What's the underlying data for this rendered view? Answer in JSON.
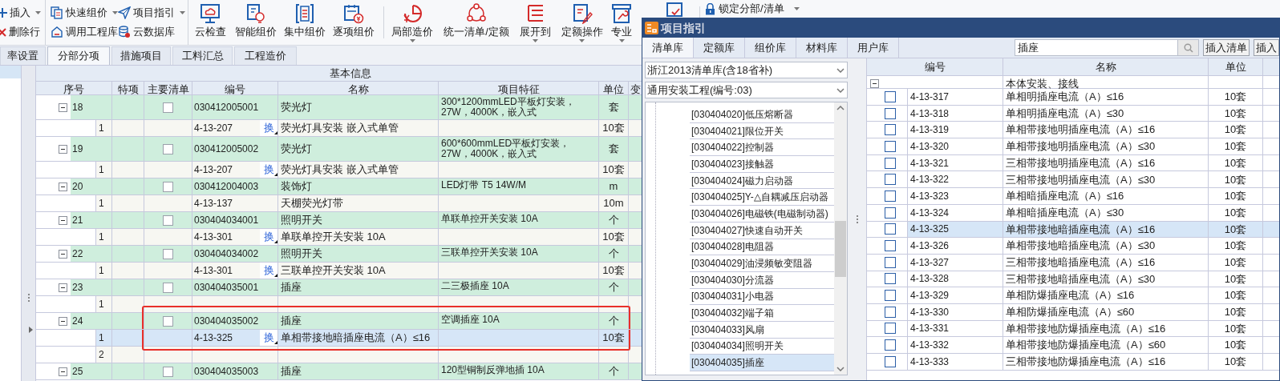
{
  "toolbar": {
    "small_buttons": [
      {
        "label": "插入",
        "dropdown": true
      },
      {
        "label": "删除行",
        "dropdown": false
      },
      {
        "label": "快速组价",
        "dropdown": true
      },
      {
        "label": "调用工程库",
        "dropdown": false
      },
      {
        "label": "项目指引",
        "dropdown": true
      },
      {
        "label": "云数据库",
        "dropdown": false
      }
    ],
    "large_buttons": [
      {
        "label": "云检查",
        "dropdown": false
      },
      {
        "label": "智能组价",
        "dropdown": false
      },
      {
        "label": "集中组价",
        "dropdown": false
      },
      {
        "label": "逐项组价",
        "dropdown": false
      },
      {
        "label": "局部造价",
        "dropdown": true
      },
      {
        "label": "统一清单/定额",
        "dropdown": false
      },
      {
        "label": "展开到",
        "dropdown": true
      },
      {
        "label": "定额操作",
        "dropdown": true
      },
      {
        "label": "专业",
        "dropdown": true
      }
    ],
    "lock_button": {
      "label": "锁定分部/清单",
      "dropdown": true
    }
  },
  "tabs": [
    {
      "label": "率设置",
      "selected": false
    },
    {
      "label": "分部分项",
      "selected": true
    },
    {
      "label": "措施项目",
      "selected": false
    },
    {
      "label": "工料汇总",
      "selected": false
    },
    {
      "label": "工程造价",
      "selected": false
    }
  ],
  "table": {
    "group_header": "基本信息",
    "columns": [
      "序号",
      "特项",
      "主要清单",
      "编号",
      "名称",
      "项目特征",
      "单位",
      "变"
    ],
    "rows": [
      {
        "kind": "item",
        "seq": "18",
        "expanded": true,
        "main_checked": false,
        "code": "030412005001",
        "name": "荧光灯",
        "features": "300*1200mmLED平板灯安装，27W，4000K，嵌入式",
        "unit": "套",
        "highlighted": false
      },
      {
        "kind": "sub",
        "seq": "1",
        "code": "4-13-207",
        "swap": "换",
        "name": "荧光灯具安装 嵌入式单管",
        "unit": "10套",
        "selected": false,
        "highlighted": false
      },
      {
        "kind": "item",
        "seq": "19",
        "expanded": true,
        "main_checked": false,
        "code": "030412005002",
        "name": "荧光灯",
        "features": "600*600mmLED平板灯安装，27W，4000K，嵌入式",
        "unit": "套",
        "highlighted": false
      },
      {
        "kind": "sub",
        "seq": "1",
        "code": "4-13-207",
        "swap": "换",
        "name": "荧光灯具安装 嵌入式单管",
        "unit": "10套",
        "selected": false,
        "highlighted": false
      },
      {
        "kind": "item",
        "seq": "20",
        "expanded": true,
        "main_checked": false,
        "code": "030412004003",
        "name": "装饰灯",
        "features": "LED灯带 T5 14W/M",
        "unit": "m",
        "highlighted": false
      },
      {
        "kind": "sub",
        "seq": "1",
        "code": "4-13-137",
        "name": "天棚荧光灯带",
        "unit": "10m",
        "selected": false,
        "highlighted": false
      },
      {
        "kind": "item",
        "seq": "21",
        "expanded": true,
        "main_checked": false,
        "code": "030404034001",
        "name": "照明开关",
        "features": "单联单控开关安装 10A",
        "unit": "个",
        "highlighted": false
      },
      {
        "kind": "sub",
        "seq": "1",
        "code": "4-13-301",
        "swap": "换",
        "name": "单联单控开关安装 10A",
        "unit": "10套",
        "selected": false,
        "highlighted": false
      },
      {
        "kind": "item",
        "seq": "22",
        "expanded": true,
        "main_checked": false,
        "code": "030404034002",
        "name": "照明开关",
        "features": "三联单控开关安装 10A",
        "unit": "个",
        "highlighted": false
      },
      {
        "kind": "sub",
        "seq": "1",
        "code": "4-13-301",
        "swap": "换",
        "name": "三联单控开关安装 10A",
        "unit": "10套",
        "selected": false,
        "highlighted": false
      },
      {
        "kind": "item",
        "seq": "23",
        "expanded": true,
        "main_checked": false,
        "code": "030404035001",
        "name": "插座",
        "features": "二三极插座 10A",
        "unit": "个",
        "highlighted": false
      },
      {
        "kind": "sub",
        "seq": "1",
        "selected": false,
        "highlighted": false
      },
      {
        "kind": "item",
        "seq": "24",
        "expanded": true,
        "main_checked": false,
        "code": "030404035002",
        "name": "插座",
        "features": "空调插座 10A",
        "unit": "个",
        "highlighted": true
      },
      {
        "kind": "sub",
        "seq": "1",
        "code": "4-13-325",
        "swap": "换",
        "name": "单相带接地暗插座电流（A）≤16",
        "unit": "10套",
        "selected": true,
        "highlighted": true
      },
      {
        "kind": "sub",
        "seq": "2",
        "selected": false,
        "highlighted": false
      },
      {
        "kind": "item",
        "seq": "25",
        "expanded": true,
        "main_checked": false,
        "code": "030404035003",
        "name": "插座",
        "features": "120型铜制反弹地插 10A",
        "unit": "个",
        "highlighted": false
      }
    ]
  },
  "dialog": {
    "title": "项目指引",
    "tabs": [
      {
        "label": "清单库",
        "selected": true
      },
      {
        "label": "定额库",
        "selected": false
      },
      {
        "label": "组价库",
        "selected": false
      },
      {
        "label": "材料库",
        "selected": false
      },
      {
        "label": "用户库",
        "selected": false
      }
    ],
    "search": {
      "value": "插座"
    },
    "buttons": [
      "插入清单",
      "插入"
    ],
    "library_select": "浙江2013清单库(含18省补)",
    "profession_select": "通用安装工程(编号:03)",
    "tree_items": [
      {
        "label": "[030404020]低压熔断器",
        "selected": false
      },
      {
        "label": "[030404021]限位开关",
        "selected": false
      },
      {
        "label": "[030404022]控制器",
        "selected": false
      },
      {
        "label": "[030404023]接触器",
        "selected": false
      },
      {
        "label": "[030404024]磁力启动器",
        "selected": false
      },
      {
        "label": "[030404025]Y-△自耦减压启动器",
        "selected": false
      },
      {
        "label": "[030404026]电磁铁(电磁制动器)",
        "selected": false
      },
      {
        "label": "[030404027]快速自动开关",
        "selected": false
      },
      {
        "label": "[030404028]电阻器",
        "selected": false
      },
      {
        "label": "[030404029]油浸频敏变阻器",
        "selected": false
      },
      {
        "label": "[030404030]分流器",
        "selected": false
      },
      {
        "label": "[030404031]小电器",
        "selected": false
      },
      {
        "label": "[030404032]端子箱",
        "selected": false
      },
      {
        "label": "[030404033]风扇",
        "selected": false
      },
      {
        "label": "[030404034]照明开关",
        "selected": false
      },
      {
        "label": "[030404035]插座",
        "selected": true
      }
    ],
    "grid": {
      "columns": [
        "编号",
        "名称",
        "单位"
      ],
      "group": {
        "name": "本体安装、接线",
        "expanded": true,
        "children": [
          {
            "code": "4-13-317",
            "name": "单相明插座电流（A）≤16",
            "unit": "10套",
            "checked": false,
            "selected": false
          },
          {
            "code": "4-13-318",
            "name": "单相明插座电流（A）≤30",
            "unit": "10套",
            "checked": false,
            "selected": false
          },
          {
            "code": "4-13-319",
            "name": "单相带接地明插座电流（A）≤16",
            "unit": "10套",
            "checked": false,
            "selected": false
          },
          {
            "code": "4-13-320",
            "name": "单相带接地明插座电流（A）≤30",
            "unit": "10套",
            "checked": false,
            "selected": false
          },
          {
            "code": "4-13-321",
            "name": "三相带接地明插座电流（A）≤16",
            "unit": "10套",
            "checked": false,
            "selected": false
          },
          {
            "code": "4-13-322",
            "name": "三相带接地明插座电流（A）≤30",
            "unit": "10套",
            "checked": false,
            "selected": false
          },
          {
            "code": "4-13-323",
            "name": "单相暗插座电流（A）≤16",
            "unit": "10套",
            "checked": false,
            "selected": false
          },
          {
            "code": "4-13-324",
            "name": "单相暗插座电流（A）≤30",
            "unit": "10套",
            "checked": false,
            "selected": false
          },
          {
            "code": "4-13-325",
            "name": "单相带接地暗插座电流（A）≤16",
            "unit": "10套",
            "checked": false,
            "selected": true
          },
          {
            "code": "4-13-326",
            "name": "单相带接地暗插座电流（A）≤30",
            "unit": "10套",
            "checked": false,
            "selected": false
          },
          {
            "code": "4-13-327",
            "name": "三相带接地暗插座电流（A）≤16",
            "unit": "10套",
            "checked": false,
            "selected": false
          },
          {
            "code": "4-13-328",
            "name": "三相带接地暗插座电流（A）≤30",
            "unit": "10套",
            "checked": false,
            "selected": false
          },
          {
            "code": "4-13-329",
            "name": "单相防爆插座电流（A）≤16",
            "unit": "10套",
            "checked": false,
            "selected": false
          },
          {
            "code": "4-13-330",
            "name": "单相防爆插座电流（A）≤60",
            "unit": "10套",
            "checked": false,
            "selected": false
          },
          {
            "code": "4-13-331",
            "name": "单相带接地防爆插座电流（A）≤16",
            "unit": "10套",
            "checked": false,
            "selected": false
          },
          {
            "code": "4-13-332",
            "name": "单相带接地防爆插座电流（A）≤60",
            "unit": "10套",
            "checked": false,
            "selected": false
          },
          {
            "code": "4-13-333",
            "name": "三相带接地防爆插座电流（A）≤16",
            "unit": "10套",
            "checked": false,
            "selected": false
          }
        ]
      }
    }
  }
}
